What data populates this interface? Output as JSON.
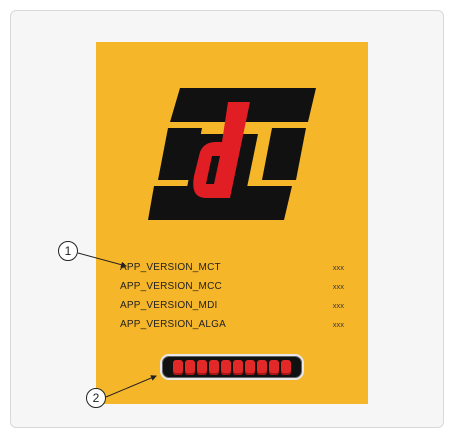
{
  "versions": [
    {
      "name": "APP_VERSION_MCT",
      "value": "xxx"
    },
    {
      "name": "APP_VERSION_MCC",
      "value": "xxx"
    },
    {
      "name": "APP_VERSION_MDI",
      "value": "xxx"
    },
    {
      "name": "APP_VERSION_ALGA",
      "value": "xxx"
    }
  ],
  "callouts": {
    "one": "1",
    "two": "2"
  },
  "progress": {
    "segments_filled": 10,
    "segments_total": 10,
    "fraction": 1.0
  },
  "colors": {
    "screen_bg": "#f6b62a",
    "logo_red": "#e01e24",
    "logo_black": "#111111",
    "segment_red": "#e32828"
  },
  "icons": {
    "logo": "cd-brand-logo-icon"
  }
}
